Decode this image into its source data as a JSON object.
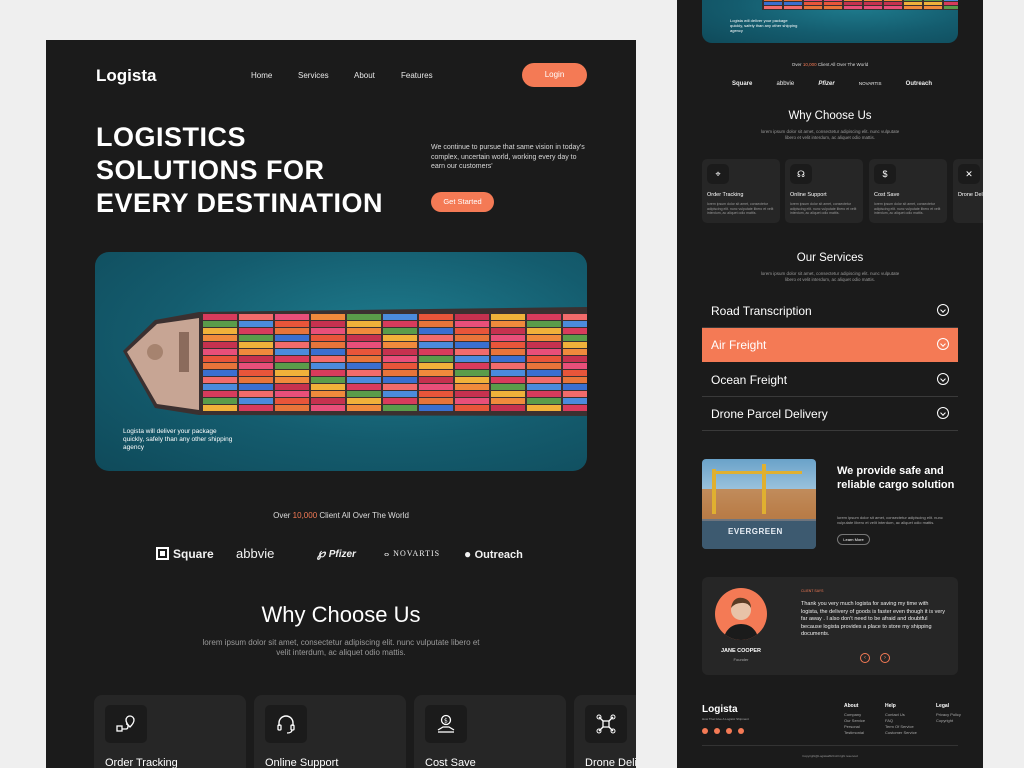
{
  "brand": {
    "name": "Logista"
  },
  "nav": {
    "items": [
      "Home",
      "Services",
      "About",
      "Features"
    ],
    "login_label": "Login"
  },
  "hero": {
    "title_lines": [
      "LOGISTICS",
      "SOLUTIONS FOR",
      "EVERY DESTINATION"
    ],
    "subtitle": "We continue to pursue that same vision in today's complex, uncertain world, working every day to earn our customers'",
    "cta_label": "Get Started",
    "image_caption": "Logista will deliver your package quickly, safely than any other shipping agency"
  },
  "clients": {
    "prefix": "Over",
    "count": "10,000",
    "suffix": "Client All Over The World",
    "brands": [
      "Square",
      "abbvie",
      "Pfizer",
      "NOVARTIS",
      "Outreach"
    ]
  },
  "why_choose": {
    "title": "Why Choose Us",
    "subtitle": "lorem ipsum dolor sit amet, consectetur adipiscing elit. nunc vulputate libero et velit interdum, ac aliquet odio mattis.",
    "cards": [
      {
        "title": "Order Tracking",
        "icon": "route-pin-icon",
        "desc": "lorem ipsum dolor sit amet, consectetur adipiscing elit. nunc vulputate libero et velit interdum, ac aliquet odio mattis."
      },
      {
        "title": "Online Support",
        "icon": "headset-icon",
        "desc": "lorem ipsum dolor sit amet, consectetur adipiscing elit. nunc vulputate libero et velit interdum, ac aliquet odio mattis."
      },
      {
        "title": "Cost Save",
        "icon": "coin-hand-icon",
        "desc": "lorem ipsum dolor sit amet, consectetur adipiscing elit. nunc vulputate libero et velit interdum, ac aliquet odio mattis."
      },
      {
        "title": "Drone Delivery",
        "icon": "drone-icon",
        "desc": "lorem ipsum dolor sit amet, consectetur adipiscing elit. nunc vulputate libero et velit interdum, ac aliquet odio mattis."
      }
    ]
  },
  "services": {
    "title": "Our Services",
    "subtitle": "lorem ipsum dolor sit amet, consectetur adipiscing elit. nunc vulputate libero et velit interdum, ac aliquet odio mattis.",
    "items": [
      "Road Transcription",
      "Air Freight",
      "Ocean Freight",
      "Drone Parcel Delivery"
    ],
    "active_index": 1
  },
  "promo": {
    "title": "We provide safe and reliable cargo solution",
    "text": "lorem ipsum dolor sit amet, consectetur adipiscing elit. nunc vulputate libero et velit interdum, ac aliquet odio mattis.",
    "button_label": "Learn More",
    "image_text": "EVERGREEN"
  },
  "testimonial": {
    "label": "CLIENT SAYS",
    "quote": "Thank you very much logista for saving my time with logista, the delivery of goods is faster even though it is very far away . I also don't need to be afraid and doubtful because logista provides a place to store my shipping documents.",
    "name": "JANE COOPER",
    "role": "Founder"
  },
  "footer": {
    "tagline": "How That Give A Logistic Shipment",
    "columns": [
      {
        "title": "About",
        "links": [
          "Company",
          "Our Service",
          "Personal",
          "Testimonial"
        ]
      },
      {
        "title": "Help",
        "links": [
          "Contact Us",
          "FAQ",
          "Term Of Service",
          "Customer Service"
        ]
      },
      {
        "title": "Legal",
        "links": [
          "Privacy Policy",
          "Copyright"
        ]
      }
    ],
    "copyright": "Copyright@Logista2024 All right reserved"
  },
  "colors": {
    "accent": "#f47a55",
    "background": "#1b1b1b",
    "card": "#262626",
    "page": "#efefef"
  }
}
